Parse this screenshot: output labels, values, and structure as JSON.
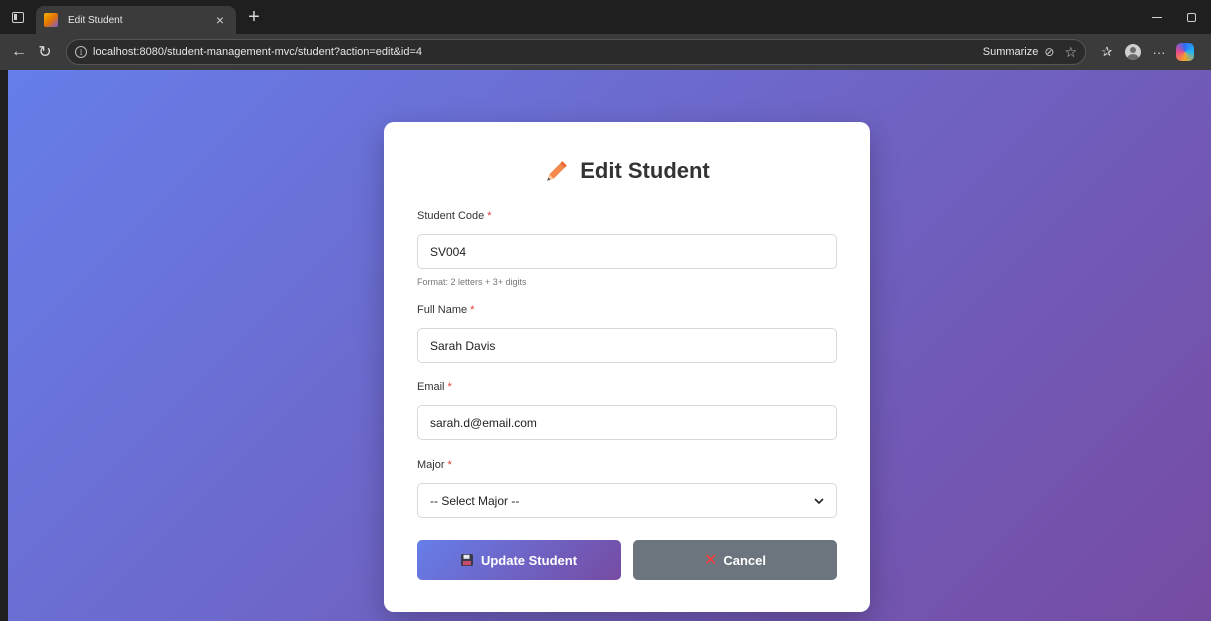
{
  "browser": {
    "tab_title": "Edit Student",
    "tab_close": "×",
    "new_tab": "+",
    "url": "localhost:8080/student-management-mvc/student?action=edit&id=4",
    "summarize_label": "Summarize",
    "more_label": "···"
  },
  "form": {
    "title": "Edit Student",
    "required_mark": "*",
    "student_code": {
      "label": "Student Code",
      "value": "SV004",
      "hint": "Format: 2 letters + 3+ digits"
    },
    "full_name": {
      "label": "Full Name",
      "value": "Sarah Davis"
    },
    "email": {
      "label": "Email",
      "value": "sarah.d@email.com"
    },
    "major": {
      "label": "Major",
      "selected": "-- Select Major --"
    },
    "update_label": "Update Student",
    "cancel_label": "Cancel"
  },
  "colors": {
    "gradient_start": "#667eea",
    "gradient_end": "#764ba2",
    "cancel_bg": "#6c757d",
    "required": "#e53935",
    "pencil": "#f4894b"
  }
}
